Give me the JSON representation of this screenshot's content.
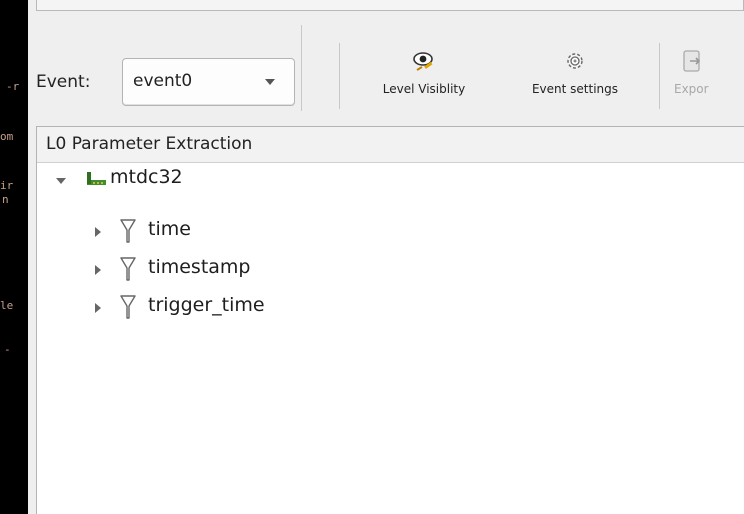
{
  "terminal": {
    "fragments": [
      "-r",
      "om",
      "ir",
      "n",
      "le",
      "-"
    ]
  },
  "toolbar": {
    "event_label": "Event:",
    "event_select_value": "event0",
    "buttons": [
      {
        "label": "Level Visiblity",
        "icon": "eye-icon",
        "enabled": true
      },
      {
        "label": "Event settings",
        "icon": "gear-icon",
        "enabled": true
      },
      {
        "label": "Expor",
        "icon": "export-icon",
        "enabled": false
      }
    ]
  },
  "tree": {
    "header": "L0 Parameter Extraction",
    "root": {
      "label": "mtdc32",
      "icon": "module-board-icon",
      "expanded": true
    },
    "children": [
      {
        "label": "time",
        "icon": "filter-icon",
        "expanded": false
      },
      {
        "label": "timestamp",
        "icon": "filter-icon",
        "expanded": false
      },
      {
        "label": "trigger_time",
        "icon": "filter-icon",
        "expanded": false
      }
    ]
  },
  "colors": {
    "terminal_bg": "#000000",
    "terminal_text": "#c8a08a",
    "window_bg": "#efefef",
    "tree_bg": "#ffffff",
    "module_icon_green": "#3f8f2f"
  }
}
